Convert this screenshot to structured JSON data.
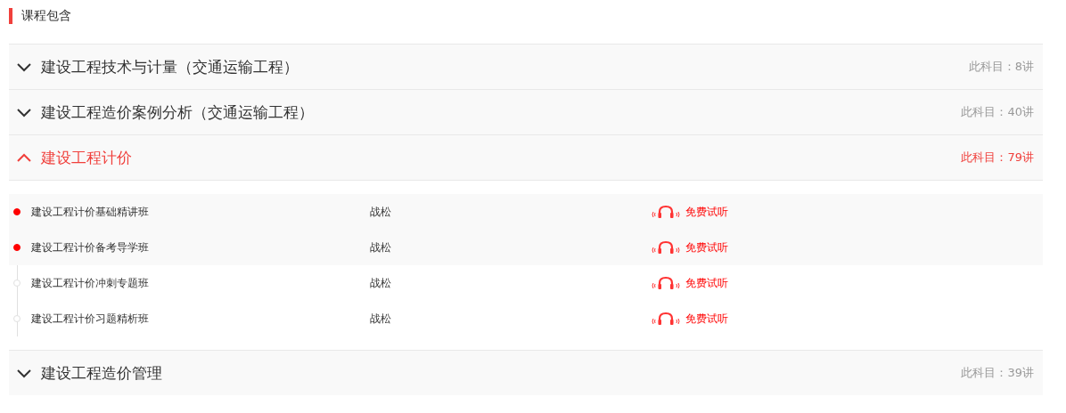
{
  "section_title": "课程包含",
  "subjects": [
    {
      "title": "建设工程技术与计量（交通运输工程）",
      "count": "此科目：8讲",
      "expanded": false
    },
    {
      "title": "建设工程造价案例分析（交通运输工程）",
      "count": "此科目：40讲",
      "expanded": false
    },
    {
      "title": "建设工程计价",
      "count": "此科目：79讲",
      "expanded": true,
      "lessons": [
        {
          "name": "建设工程计价基础精讲班",
          "teacher": "战松",
          "trial": "免费试听",
          "active": true
        },
        {
          "name": "建设工程计价备考导学班",
          "teacher": "战松",
          "trial": "免费试听",
          "active": true
        },
        {
          "name": "建设工程计价冲刺专题班",
          "teacher": "战松",
          "trial": "免费试听",
          "active": false
        },
        {
          "name": "建设工程计价习题精析班",
          "teacher": "战松",
          "trial": "免费试听",
          "active": false
        }
      ]
    },
    {
      "title": "建设工程造价管理",
      "count": "此科目：39讲",
      "expanded": false
    }
  ]
}
